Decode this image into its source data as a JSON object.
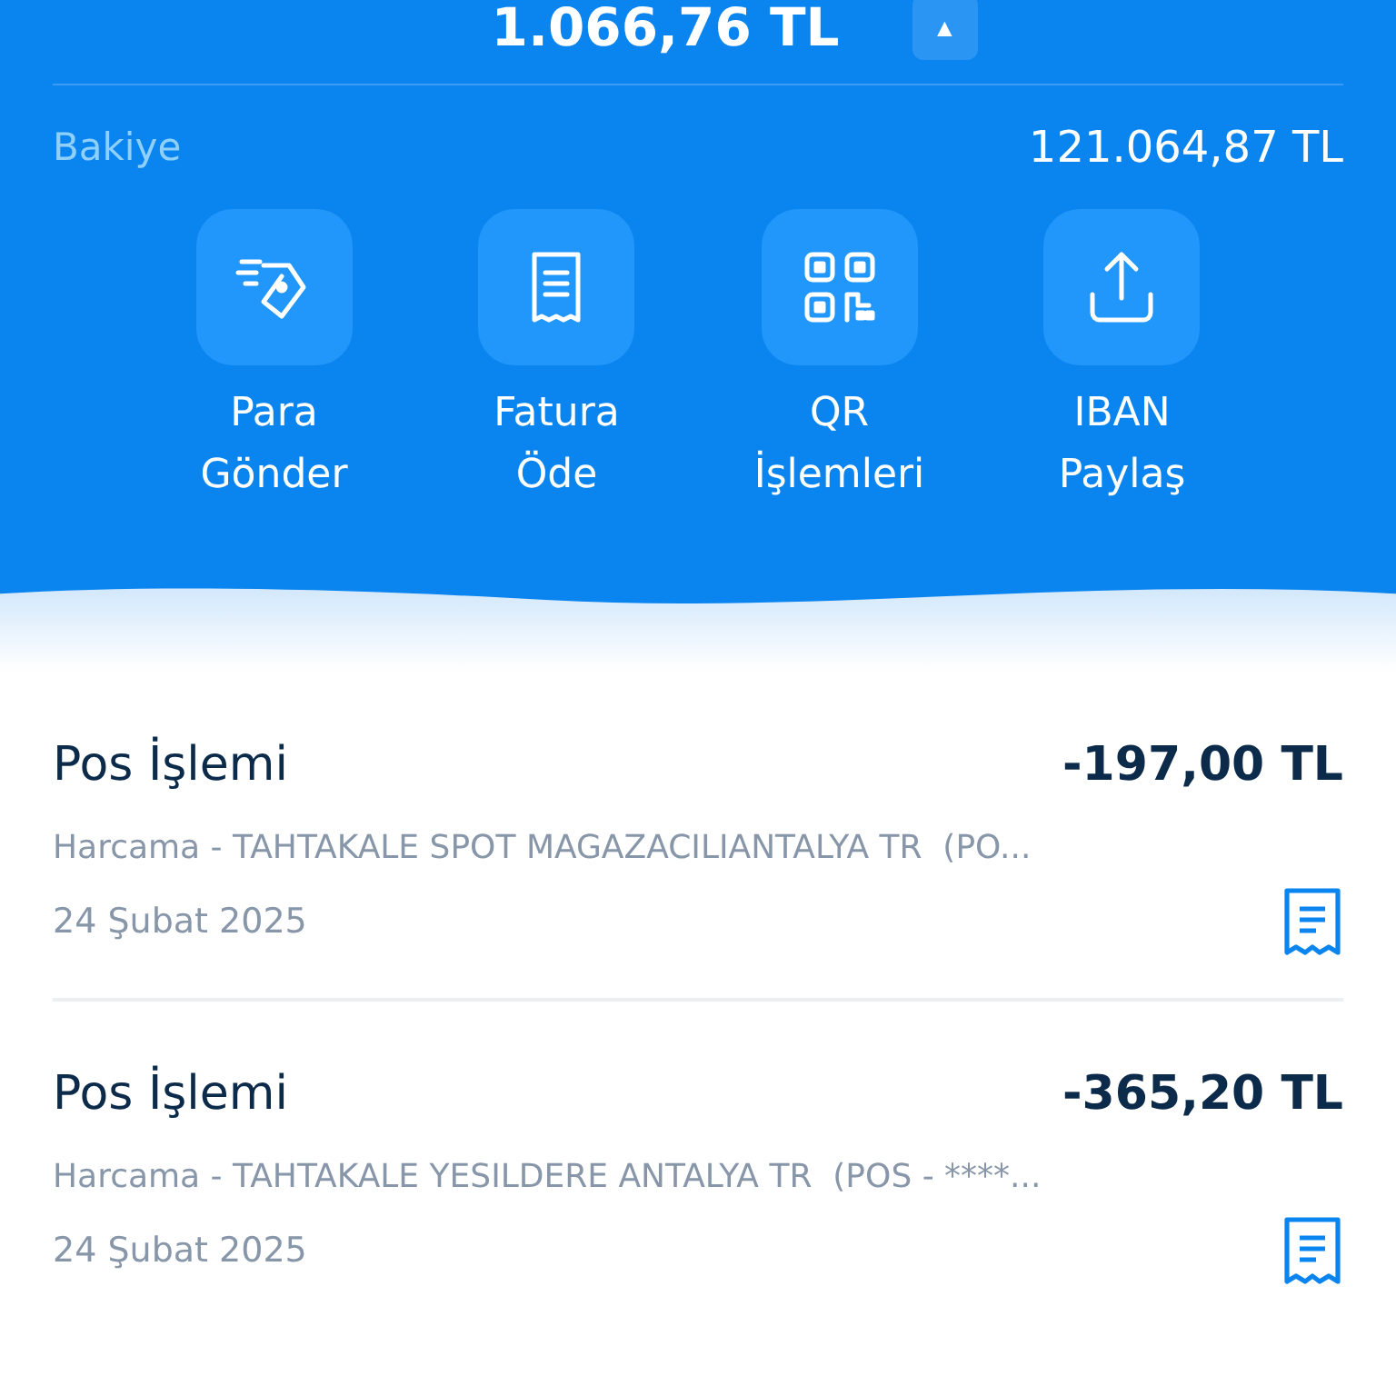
{
  "header": {
    "amount": "1.066,76 TL",
    "toggle": "▲",
    "balance_label": "Bakiye",
    "balance": "121.064,87 TL"
  },
  "actions": [
    {
      "kind": "send",
      "label": "Para Gönder"
    },
    {
      "kind": "bill",
      "label": "Fatura Öde"
    },
    {
      "kind": "qr",
      "label": "QR İşlemleri"
    },
    {
      "kind": "share",
      "label": "IBAN Paylaş"
    }
  ],
  "transactions": [
    {
      "title": "Pos İşlemi",
      "amount": "-197,00 TL",
      "description": "Harcama - TAHTAKALE SPOT MAGAZACILIANTALYA TR  (PO...",
      "date": "24 Şubat 2025"
    },
    {
      "title": "Pos İşlemi",
      "amount": "-365,20 TL",
      "description": "Harcama - TAHTAKALE YESILDERE ANTALYA TR  (POS - ****...",
      "date": "24 Şubat 2025"
    }
  ]
}
